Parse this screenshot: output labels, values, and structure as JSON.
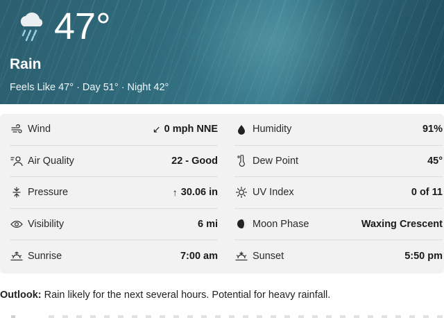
{
  "current": {
    "temperature": "47°",
    "condition": "Rain",
    "feels_like": "Feels Like 47° · Day 51° · Night 42°",
    "condition_icon": "rain-cloud-icon"
  },
  "details_left": [
    {
      "label": "Wind",
      "value": "0 mph NNE",
      "prefix": "↙",
      "icon": "wind-icon"
    },
    {
      "label": "Air Quality",
      "value": "22 - Good",
      "prefix": "",
      "icon": "air-quality-icon"
    },
    {
      "label": "Pressure",
      "value": "30.06 in",
      "prefix": "↑",
      "icon": "pressure-icon"
    },
    {
      "label": "Visibility",
      "value": "6 mi",
      "prefix": "",
      "icon": "eye-icon"
    },
    {
      "label": "Sunrise",
      "value": "7:00 am",
      "prefix": "",
      "icon": "sunrise-icon"
    }
  ],
  "details_right": [
    {
      "label": "Humidity",
      "value": "91%",
      "icon": "droplet-icon"
    },
    {
      "label": "Dew Point",
      "value": "45°",
      "icon": "thermometer-icon"
    },
    {
      "label": "UV Index",
      "value": "0 of 11",
      "icon": "sun-icon"
    },
    {
      "label": "Moon Phase",
      "value": "Waxing Crescent",
      "icon": "moon-icon"
    },
    {
      "label": "Sunset",
      "value": "5:50 pm",
      "icon": "sunset-icon"
    }
  ],
  "outlook": {
    "label": "Outlook:",
    "text": " Rain likely for the next several hours. Potential for heavy rainfall."
  },
  "colors": {
    "hero_bg": "#2f6b7c",
    "panel_bg": "#f2f2f2"
  }
}
